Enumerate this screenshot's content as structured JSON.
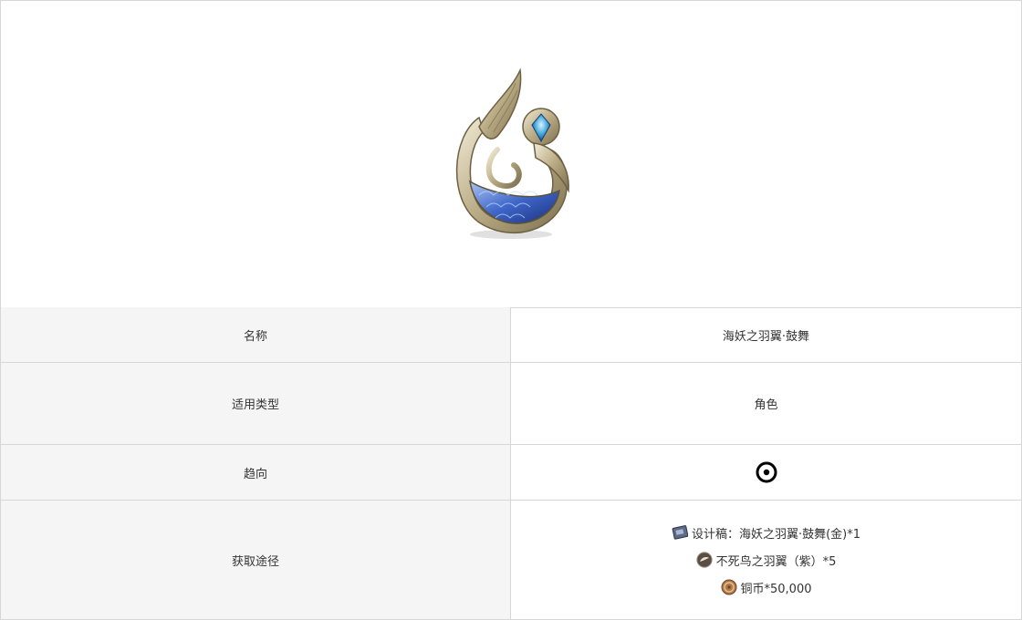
{
  "item": {
    "image_icon": "mermaid-feather-wing-emblem",
    "rows": {
      "name": {
        "label": "名称",
        "value": "海妖之羽翼·鼓舞"
      },
      "type": {
        "label": "适用类型",
        "value": "角色"
      },
      "tendency": {
        "label": "趋向",
        "icon": "circle-dot-icon"
      },
      "acquire": {
        "label": "获取途径",
        "items": [
          {
            "icon": "blueprint-card-icon",
            "text": "设计稿：海妖之羽翼·鼓舞(金)*1"
          },
          {
            "icon": "phoenix-wing-orb-icon",
            "text": "不死鸟之羽翼（紫）*5"
          },
          {
            "icon": "copper-coin-icon",
            "text": "铜币*50,000"
          }
        ]
      }
    }
  },
  "colors": {
    "border": "#d6d6d6",
    "label_bg": "#f5f5f5",
    "text": "#333333"
  }
}
